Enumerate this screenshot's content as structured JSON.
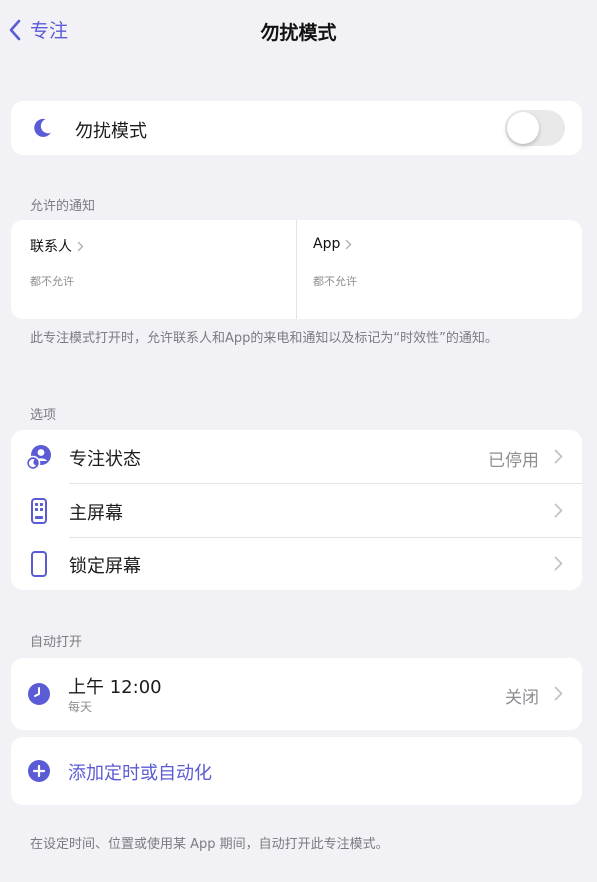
{
  "colors": {
    "accent": "#5b5bd6",
    "background": "#f2f2f6",
    "card": "#ffffff",
    "secondary_text": "#8e8e93",
    "toggle_off": "#e9e9ea"
  },
  "nav": {
    "back_label": "专注",
    "title": "勿扰模式"
  },
  "dnd": {
    "icon": "moon-icon",
    "label": "勿扰模式",
    "toggle_on": false
  },
  "allowed": {
    "section_label": "允许的通知",
    "people": {
      "title": "联系人",
      "subtitle": "都不允许"
    },
    "apps": {
      "title": "App",
      "subtitle": "都不允许"
    },
    "footnote": "此专注模式打开时，允许联系人和App的来电和通知以及标记为“时效性”的通知。"
  },
  "options": {
    "section_label": "选项",
    "items": [
      {
        "icon": "focus-status-icon",
        "label": "专注状态",
        "value": "已停用"
      },
      {
        "icon": "home-screen-icon",
        "label": "主屏幕",
        "value": ""
      },
      {
        "icon": "lock-screen-icon",
        "label": "锁定屏幕",
        "value": ""
      }
    ]
  },
  "auto": {
    "section_label": "自动打开",
    "schedule": {
      "icon": "clock-icon",
      "time": "上午 12:00",
      "repeat": "每天",
      "value": "关闭"
    },
    "add_label": "添加定时或自动化",
    "footnote": "在设定时间、位置或使用某 App 期间，自动打开此专注模式。"
  }
}
